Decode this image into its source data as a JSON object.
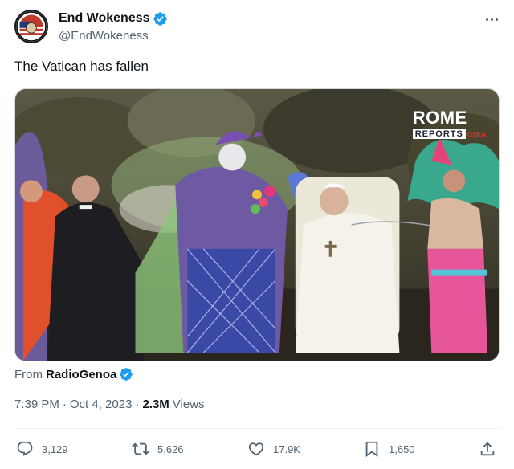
{
  "author": {
    "display_name": "End Wokeness",
    "handle": "@EndWokeness",
    "avatar_icon": "end-wokeness-avatar-icon",
    "verified_icon": "verified-badge-icon",
    "verified_color": "#1d9bf0"
  },
  "tweet": {
    "text": "The Vatican has fallen"
  },
  "media": {
    "watermark_line1": "ROME",
    "watermark_line2": "REPORTS",
    "watermark_line3": "OSKA"
  },
  "source": {
    "prefix": "From",
    "name": "RadioGenoa"
  },
  "meta": {
    "time": "7:39 PM",
    "date": "Oct 4, 2023",
    "views_count": "2.3M",
    "views_label": "Views"
  },
  "actions": {
    "replies": "3,129",
    "reposts": "5,626",
    "likes": "17.9K",
    "bookmarks": "1,650"
  },
  "colors": {
    "text_primary": "#0f1419",
    "text_secondary": "#536471",
    "accent": "#1d9bf0"
  }
}
